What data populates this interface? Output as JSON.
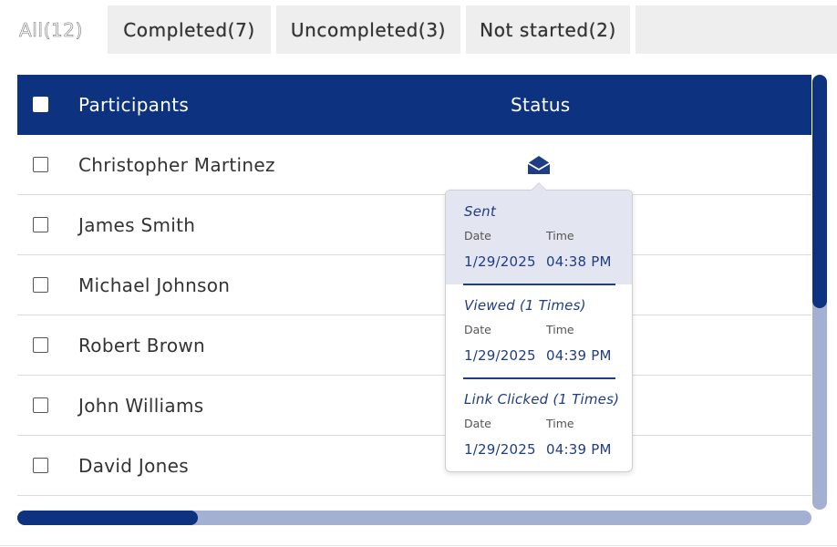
{
  "tabs": [
    {
      "label": "All(12)",
      "active": true
    },
    {
      "label": "Completed(7)",
      "active": false
    },
    {
      "label": "Uncompleted(3)",
      "active": false
    },
    {
      "label": "Not started(2)",
      "active": false
    }
  ],
  "table": {
    "headers": {
      "participants": "Participants",
      "status": "Status"
    },
    "rows": [
      {
        "name": "Christopher Martinez",
        "status_icon": "envelope-open-icon"
      },
      {
        "name": "James Smith"
      },
      {
        "name": "Michael Johnson"
      },
      {
        "name": "Robert Brown"
      },
      {
        "name": "John Williams"
      },
      {
        "name": "David Jones"
      }
    ]
  },
  "popover": {
    "sections": [
      {
        "title": "Sent",
        "date_label": "Date",
        "time_label": "Time",
        "date": "1/29/2025",
        "time": "04:38 PM"
      },
      {
        "title": "Viewed (1 Times)",
        "date_label": "Date",
        "time_label": "Time",
        "date": "1/29/2025",
        "time": "04:39 PM"
      },
      {
        "title": "Link Clicked (1 Times)",
        "date_label": "Date",
        "time_label": "Time",
        "date": "1/29/2025",
        "time": "04:39 PM"
      }
    ]
  },
  "colors": {
    "header_bg": "#0d3380",
    "accent_text": "#1f3d85",
    "scroll_track": "#a3b0d1",
    "tab_bg": "#eeeeee"
  }
}
